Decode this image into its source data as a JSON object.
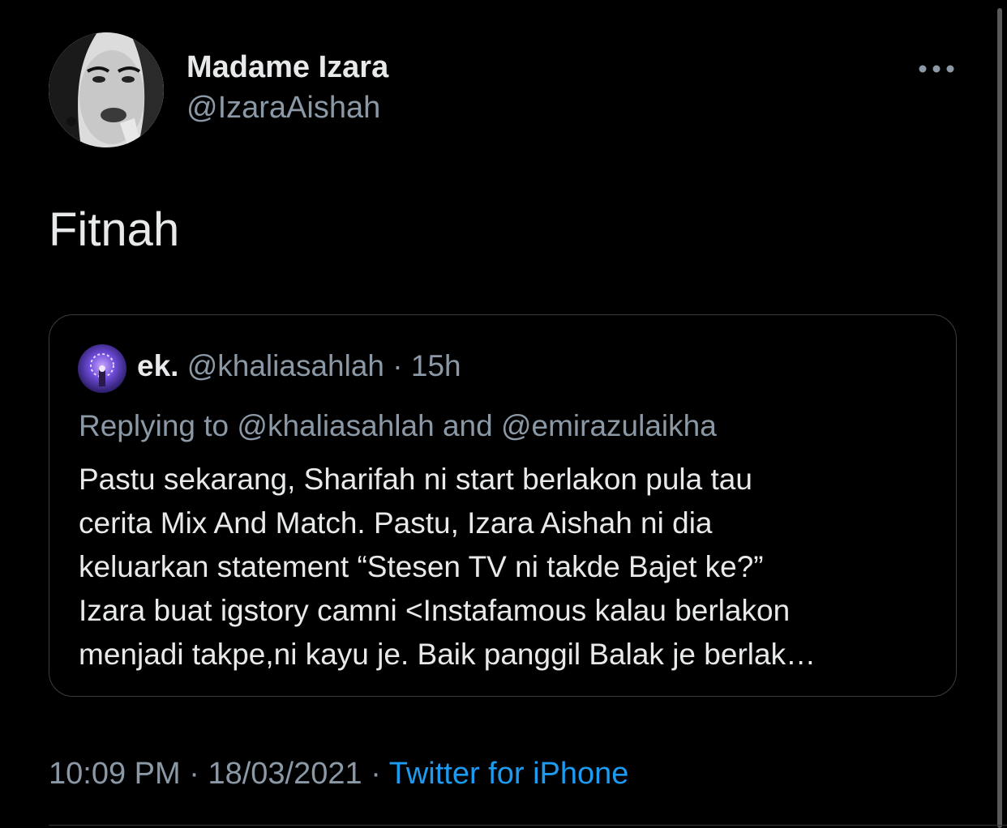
{
  "tweet": {
    "author": {
      "display_name": "Madame Izara",
      "handle": "@IzaraAishah",
      "avatar_icon": "profile-photo"
    },
    "more_icon": "more-horizontal-icon",
    "text": "Fitnah",
    "timestamp_time": "10:09 PM",
    "separator": "·",
    "timestamp_date": "18/03/2021",
    "source": "Twitter for iPhone"
  },
  "quoted_tweet": {
    "display_name": "ek.",
    "handle": "@khaliasahlah",
    "separator": "·",
    "time_ago": "15h",
    "replying_prefix": "Replying to",
    "replying_to_1": "@khaliasahlah",
    "replying_and": "and",
    "replying_to_2": "@emirazulaikha",
    "lines": [
      "Pastu sekarang, Sharifah ni start berlakon pula tau",
      "cerita Mix And Match. Pastu, Izara Aishah ni dia",
      "keluarkan statement “Stesen TV ni takde Bajet ke?”",
      "Izara buat igstory camni <Instafamous kalau berlakon",
      "menjadi takpe,ni kayu je. Baik panggil Balak je berlak…"
    ]
  },
  "colors": {
    "background": "#000000",
    "text_primary": "#e7e9ea",
    "text_secondary": "#8b98a5",
    "link": "#1d9bf0",
    "border": "#3a3d40"
  }
}
